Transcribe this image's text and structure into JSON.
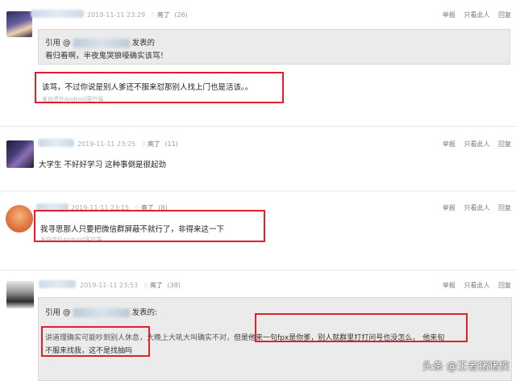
{
  "actions": {
    "report": "举报",
    "only_user": "只看此人",
    "reply": "回复"
  },
  "posts": [
    {
      "time": "2019-11-11 23:29",
      "like_label": "亮了",
      "like_count": "(26)",
      "quote_prefix": "引用 @",
      "quote_suffix": "发表的",
      "quote_text": "看归看啊，半夜鬼哭狼嚎确实该骂！",
      "content": "该骂，不过你说是别人爹还不服来怼那别人找上门也是活该。。",
      "source": "发自虎扑Android客户端"
    },
    {
      "time": "2019-11-11 23:25",
      "like_label": "亮了",
      "like_count": "(11)",
      "content": "大学生 不好好学习 这种事倒是很起劲"
    },
    {
      "time": "2019-11-11 23:15",
      "like_label": "亮了",
      "like_count": "(8)",
      "content": "我寻思那人只要把微信群屏蔽不就行了，非得来这一下",
      "source": "发自虎扑Android客户端"
    },
    {
      "time": "2019-11-11 23:53",
      "like_label": "亮了",
      "like_count": "(38)",
      "quote_prefix": "引用 @",
      "quote_suffix": "发表的:",
      "quote_line1_a": "讲道理确实可能吵到别人休息，大晚上大吼大叫确实不对，",
      "quote_line1_b": "但是他来一句fpx是你爹，别人就群里打打问号也没怎么，",
      "quote_line1_c": "他来旬",
      "quote_line2": "不服来找我，这不是找抽吗"
    }
  ],
  "watermark": "头条 @王者猪猪侠"
}
